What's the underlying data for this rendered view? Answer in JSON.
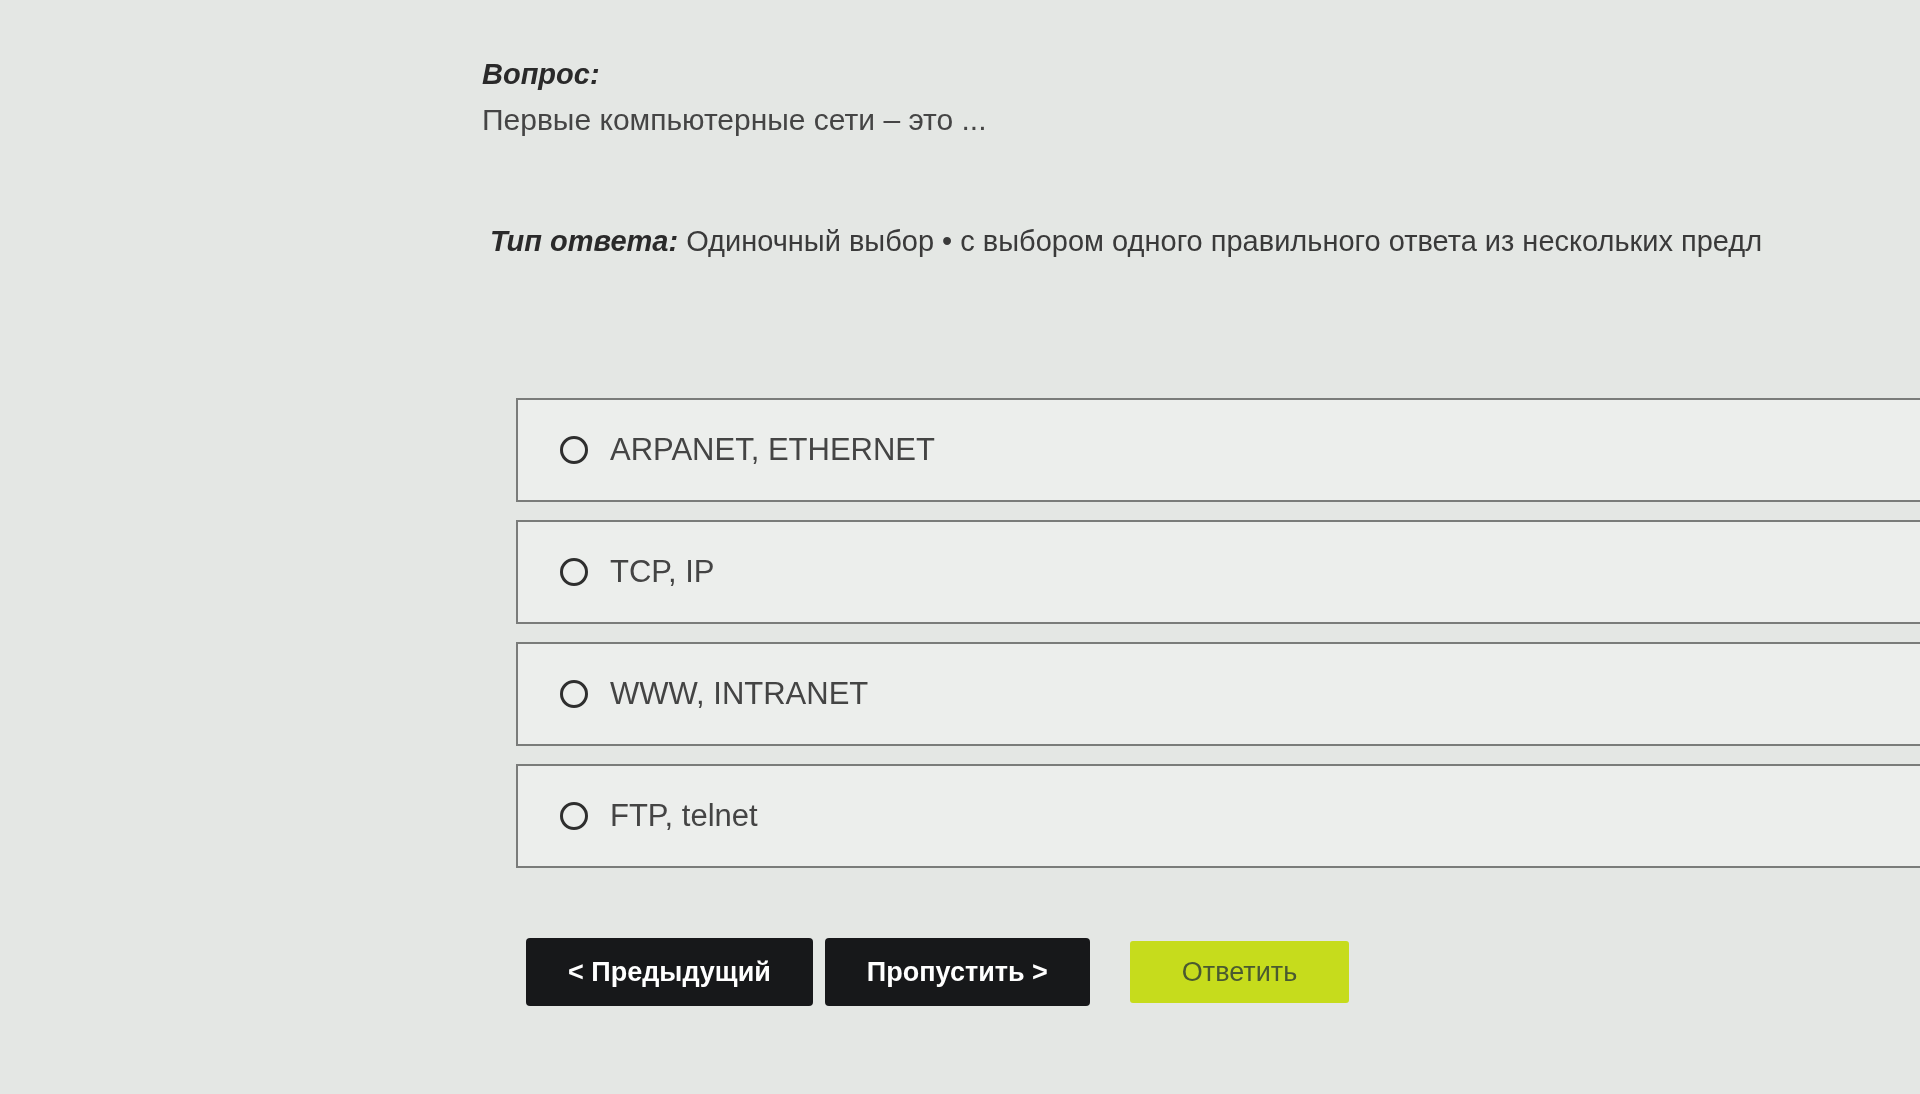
{
  "question": {
    "label": "Вопрос:",
    "text": "Первые компьютерные сети – это ..."
  },
  "answer_type": {
    "label": "Тип ответа:",
    "value": "Одиночный выбор • с выбором одного правильного ответа из нескольких предл"
  },
  "options": [
    {
      "label": "ARPANET, ETHERNET",
      "selected": false
    },
    {
      "label": "TCP, IP",
      "selected": false
    },
    {
      "label": "WWW, INTRANET",
      "selected": false
    },
    {
      "label": "FTP, telnet",
      "selected": false
    }
  ],
  "buttons": [
    {
      "label": "< Предыдущий",
      "kind": "secondary"
    },
    {
      "label": "Пропустить >",
      "kind": "secondary"
    },
    {
      "label": "Ответить",
      "kind": "primary"
    }
  ]
}
